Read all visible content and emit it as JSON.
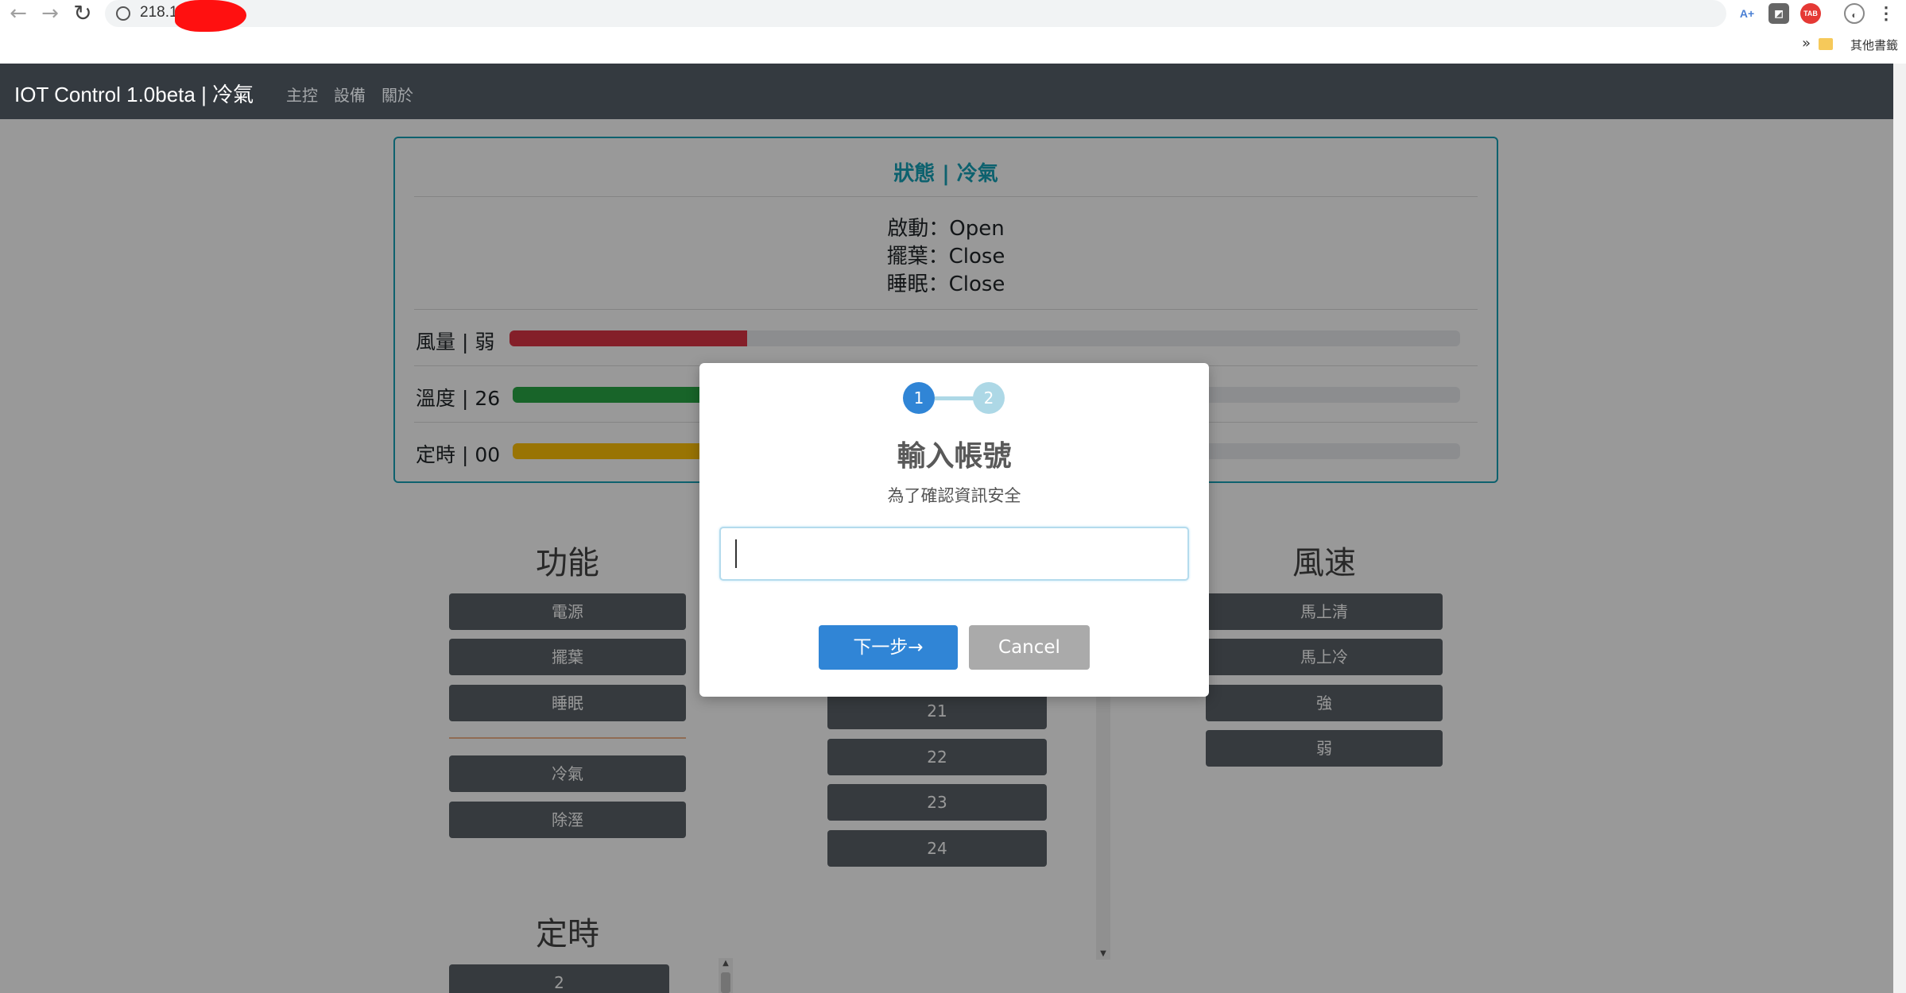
{
  "browser": {
    "address_text": "218.17",
    "bookmark_folder_label": "其他書籤",
    "bookmarks_more": "»",
    "ext_icons": [
      "A+",
      "◩",
      "TAB",
      "◐",
      "⋮"
    ]
  },
  "navbar": {
    "brand": "IOT Control 1.0beta | 冷氣",
    "links": [
      "主控",
      "設備",
      "關於"
    ]
  },
  "status": {
    "title": "狀態 | 冷氣",
    "lines": [
      "啟動：Open",
      "擺葉：Close",
      "睡眠：Close"
    ],
    "bars": [
      {
        "label": "風量 | 弱",
        "color": "#dc3545",
        "level": 0.25
      },
      {
        "label": "溫度 | 26",
        "color": "#28a745",
        "level": 0.6
      },
      {
        "label": "定時 | 00",
        "color": "#ffc107",
        "level": 0.3
      }
    ]
  },
  "functions": {
    "title": "功能",
    "buttons": [
      "電源",
      "擺葉",
      "睡眠"
    ],
    "mode_buttons": [
      "冷氣",
      "除溼"
    ]
  },
  "temperature": {
    "buttons": [
      "21",
      "22",
      "23",
      "24"
    ]
  },
  "fan_speed": {
    "title": "風速",
    "buttons": [
      "馬上清",
      "馬上冷",
      "強",
      "弱"
    ]
  },
  "timer": {
    "title": "定時",
    "buttons": [
      "2"
    ]
  },
  "modal": {
    "steps": [
      "1",
      "2"
    ],
    "title": "輸入帳號",
    "subtitle": "為了確認資訊安全",
    "input_value": "",
    "next_label": "下一步→",
    "cancel_label": "Cancel"
  }
}
